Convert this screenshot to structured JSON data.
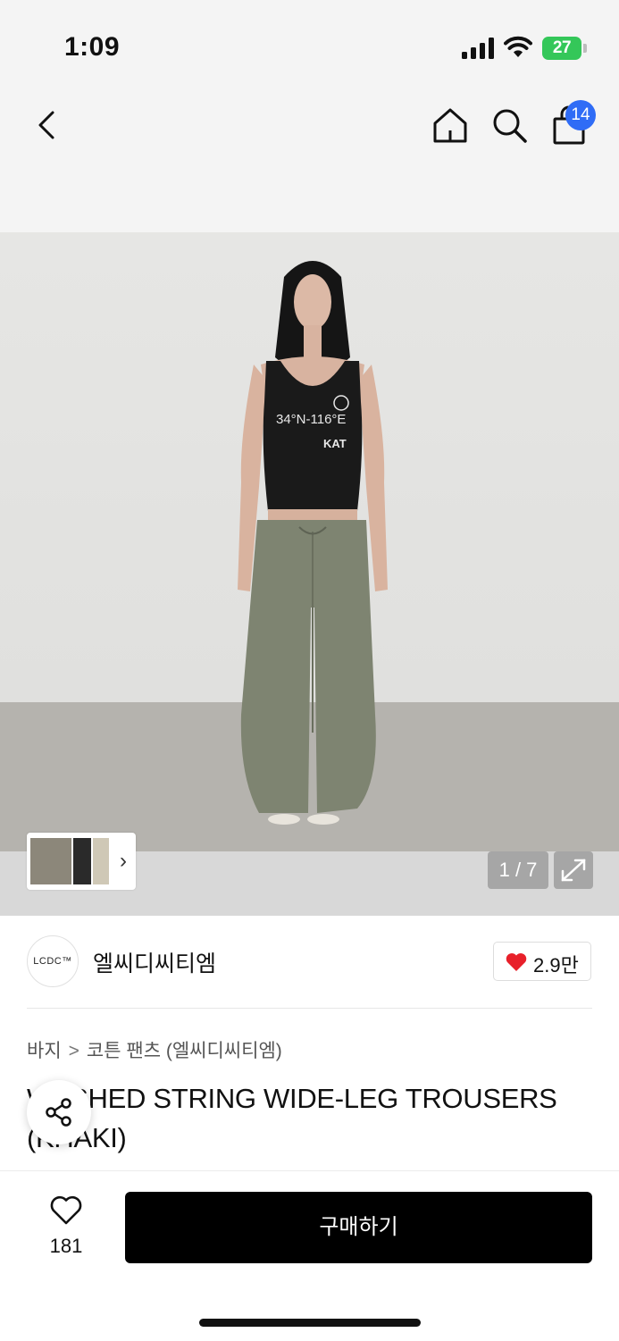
{
  "status": {
    "time": "1:09",
    "battery": "27"
  },
  "nav": {
    "cart_count": "14"
  },
  "gallery": {
    "counter": "1 / 7",
    "shirt_print_line1": "34°N-116°E",
    "shirt_print_line2": "KAT"
  },
  "brand": {
    "logo_text": "LCDC™",
    "name": "엘씨디씨티엠",
    "likes": "2.9만"
  },
  "breadcrumb": {
    "category": "바지",
    "separator": ">",
    "subcategory": "코튼 팬츠 (엘씨디씨티엠)"
  },
  "product": {
    "title": "WASHED STRING WIDE-LEG TROUSERS (KHAKI)"
  },
  "bottom": {
    "wish_count": "181",
    "buy_label": "구매하기"
  },
  "colors": {
    "accent_blue": "#2f6cf6",
    "battery_green": "#34c759",
    "heart_red": "#e8202a",
    "buy_black": "#000000"
  }
}
